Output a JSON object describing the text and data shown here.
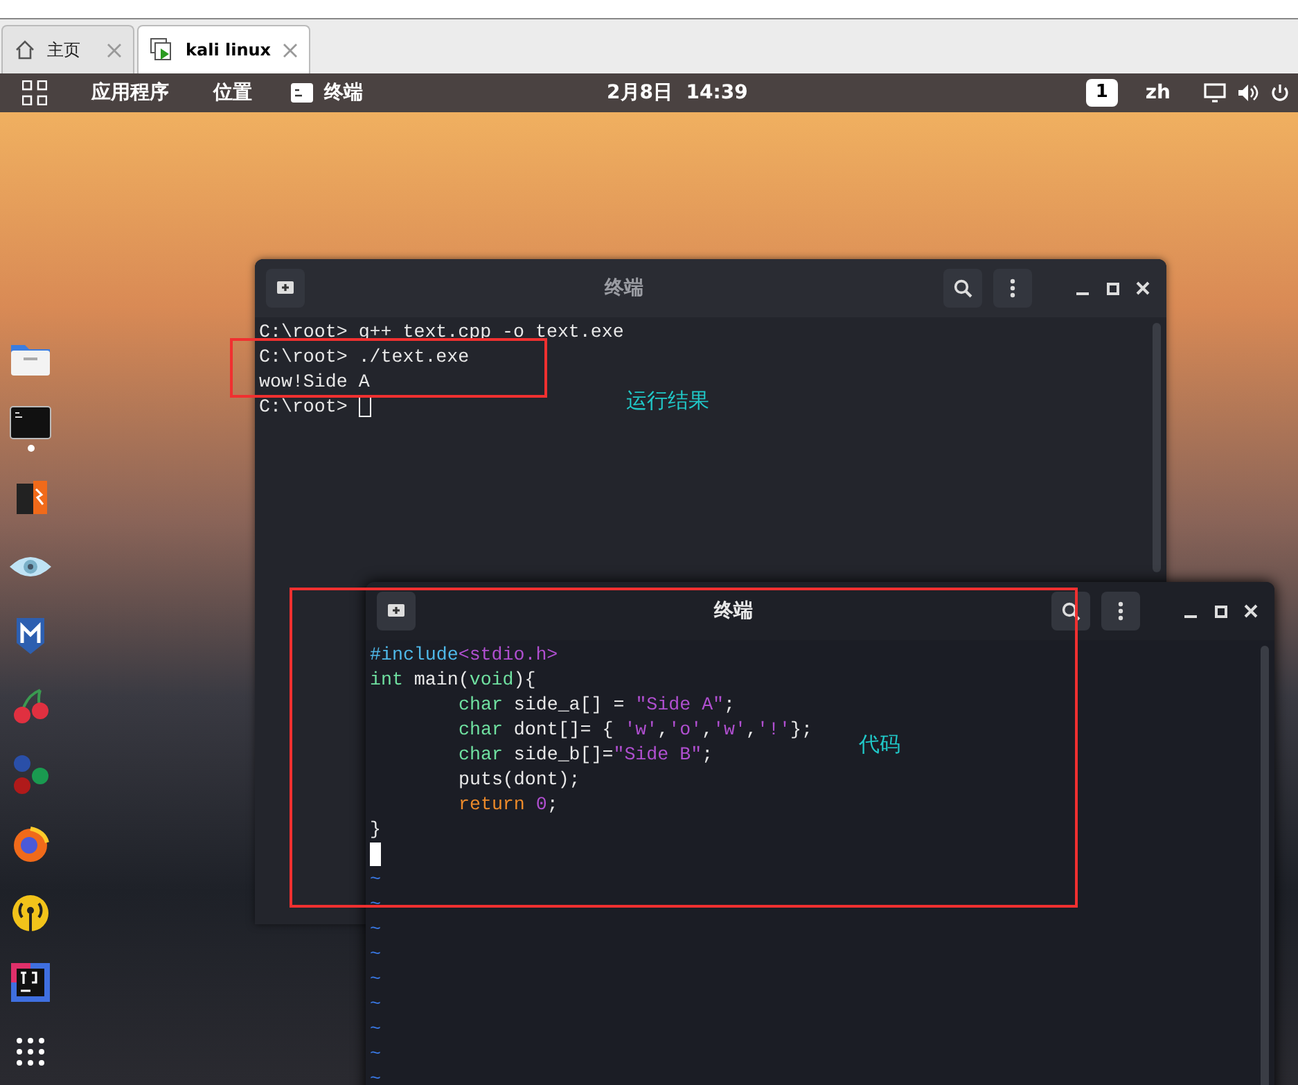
{
  "browser_tabs": [
    {
      "label": "主页",
      "selected": false
    },
    {
      "label": "kali linux",
      "selected": true
    }
  ],
  "top_bar": {
    "menus": [
      "应用程序",
      "位置"
    ],
    "app": "终端",
    "clock": "2月8日  14:39",
    "workspace": "1",
    "language": "zh"
  },
  "dock": [
    {
      "kind": "files",
      "running": false
    },
    {
      "kind": "terminal",
      "running": true
    },
    {
      "kind": "burp",
      "running": false
    },
    {
      "kind": "eye",
      "running": false
    },
    {
      "kind": "shield",
      "running": false
    },
    {
      "kind": "cherry",
      "running": false
    },
    {
      "kind": "dots",
      "running": false
    },
    {
      "kind": "firefox",
      "running": false
    },
    {
      "kind": "radio",
      "running": false
    },
    {
      "kind": "ide",
      "running": false
    },
    {
      "kind": "grid",
      "running": false
    }
  ],
  "windows": [
    {
      "title": "终端",
      "focused": false,
      "lines": [
        {
          "indent": false,
          "segments": [
            {
              "text": "C:\\root> g++ text.cpp -o text.exe",
              "kind": "plain"
            }
          ]
        },
        {
          "indent": false,
          "segments": [
            {
              "text": "C:\\root> ./text.exe",
              "kind": "plain"
            }
          ]
        },
        {
          "indent": false,
          "segments": [
            {
              "text": "wow!Side A",
              "kind": "plain"
            }
          ]
        },
        {
          "indent": false,
          "segments": [
            {
              "text": "C:\\root> ",
              "kind": "plain"
            },
            {
              "kind": "cursor_hollow"
            }
          ]
        }
      ]
    },
    {
      "title": "终端",
      "focused": true,
      "lines": [
        {
          "indent": false,
          "segments": [
            {
              "text": "#include",
              "kind": "preproc"
            },
            {
              "text": "<stdio.h>",
              "kind": "string"
            }
          ]
        },
        {
          "indent": false,
          "segments": [
            {
              "text": "int",
              "kind": "type"
            },
            {
              "text": " main(",
              "kind": "plain"
            },
            {
              "text": "void",
              "kind": "type"
            },
            {
              "text": "){",
              "kind": "plain"
            }
          ]
        },
        {
          "indent": true,
          "segments": [
            {
              "text": "char",
              "kind": "type"
            },
            {
              "text": " side_a[] = ",
              "kind": "plain"
            },
            {
              "text": "\"Side A\"",
              "kind": "string"
            },
            {
              "text": ";",
              "kind": "plain"
            }
          ]
        },
        {
          "indent": true,
          "segments": [
            {
              "text": "char",
              "kind": "type"
            },
            {
              "text": " dont[]= { ",
              "kind": "plain"
            },
            {
              "text": "'w'",
              "kind": "string"
            },
            {
              "text": ",",
              "kind": "plain"
            },
            {
              "text": "'o'",
              "kind": "string"
            },
            {
              "text": ",",
              "kind": "plain"
            },
            {
              "text": "'w'",
              "kind": "string"
            },
            {
              "text": ",",
              "kind": "plain"
            },
            {
              "text": "'!'",
              "kind": "string"
            },
            {
              "text": "};",
              "kind": "plain"
            }
          ]
        },
        {
          "indent": true,
          "segments": [
            {
              "text": "char",
              "kind": "type"
            },
            {
              "text": " side_b[]=",
              "kind": "plain"
            },
            {
              "text": "\"Side B\"",
              "kind": "string"
            },
            {
              "text": ";",
              "kind": "plain"
            }
          ]
        },
        {
          "indent": true,
          "segments": [
            {
              "text": "puts(dont);",
              "kind": "plain"
            }
          ]
        },
        {
          "indent": true,
          "segments": [
            {
              "text": "return ",
              "kind": "keyword"
            },
            {
              "text": "0",
              "kind": "string"
            },
            {
              "text": ";",
              "kind": "plain"
            }
          ]
        },
        {
          "indent": false,
          "segments": [
            {
              "text": "}",
              "kind": "plain"
            }
          ]
        },
        {
          "indent": false,
          "segments": [
            {
              "kind": "cursor_block"
            }
          ]
        },
        {
          "indent": false,
          "segments": [
            {
              "text": "~",
              "kind": "tilde"
            }
          ]
        },
        {
          "indent": false,
          "segments": [
            {
              "text": "~",
              "kind": "tilde"
            }
          ]
        },
        {
          "indent": false,
          "segments": [
            {
              "text": "~",
              "kind": "tilde"
            }
          ]
        },
        {
          "indent": false,
          "segments": [
            {
              "text": "~",
              "kind": "tilde"
            }
          ]
        },
        {
          "indent": false,
          "segments": [
            {
              "text": "~",
              "kind": "tilde"
            }
          ]
        },
        {
          "indent": false,
          "segments": [
            {
              "text": "~",
              "kind": "tilde"
            }
          ]
        },
        {
          "indent": false,
          "segments": [
            {
              "text": "~",
              "kind": "tilde"
            }
          ]
        },
        {
          "indent": false,
          "segments": [
            {
              "text": "~",
              "kind": "tilde"
            }
          ]
        },
        {
          "indent": false,
          "segments": [
            {
              "text": "~",
              "kind": "tilde"
            }
          ]
        }
      ]
    }
  ],
  "annotations": [
    {
      "label": "运行结果"
    },
    {
      "label": "代码"
    }
  ]
}
